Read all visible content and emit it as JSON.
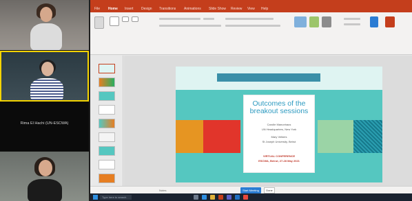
{
  "participants": {
    "tile3_name": "Rima El Hachi (UN-ESCWA)"
  },
  "powerpoint": {
    "menu": [
      "File",
      "Home",
      "Insert",
      "Design",
      "Transitions",
      "Animations",
      "Slide Show",
      "Review",
      "View",
      "Help"
    ],
    "slide": {
      "title": "Outcomes of the breakout sessions",
      "lines": [
        "Carolle Manunhaus",
        "UN Headquarters, New York",
        "Mary Velkers",
        "St Joseph University, Beirut"
      ],
      "conference": "VIRTUAL CONFERENCE",
      "conference_sub": "ESCWA, Beirut, 27-28 May 2021"
    },
    "notes_placeholder": "Notes",
    "primary_button": "Start Meeting",
    "secondary_button": "Done"
  },
  "taskbar": {
    "search_placeholder": "Type here to search"
  },
  "colors": {
    "accent": "#c43e1c",
    "slide_bg": "#55c7c0"
  }
}
